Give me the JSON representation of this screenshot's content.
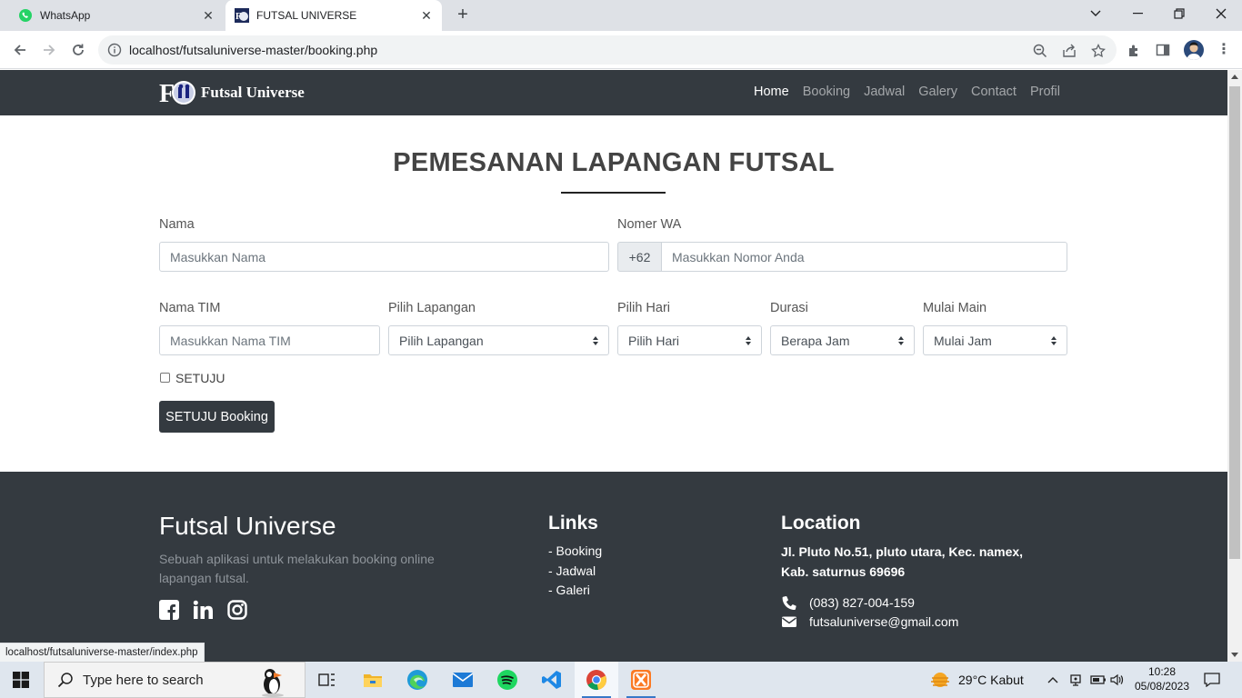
{
  "browser": {
    "tabs": [
      {
        "title": "WhatsApp",
        "icon": "whatsapp-icon"
      },
      {
        "title": "FUTSAL UNIVERSE",
        "icon": "futsal-logo-icon"
      }
    ],
    "url": "localhost/futsaluniverse-master/booking.php",
    "status_url": "localhost/futsaluniverse-master/index.php"
  },
  "site": {
    "brand": "Futsal Universe",
    "nav": [
      "Home",
      "Booking",
      "Jadwal",
      "Galery",
      "Contact",
      "Profil"
    ],
    "active_nav": "Home"
  },
  "form": {
    "title": "PEMESANAN LAPANGAN FUTSAL",
    "nama_label": "Nama",
    "nama_placeholder": "Masukkan Nama",
    "wa_label": "Nomer WA",
    "wa_prefix": "+62",
    "wa_placeholder": "Masukkan Nomor Anda",
    "tim_label": "Nama TIM",
    "tim_placeholder": "Masukkan Nama TIM",
    "lapangan_label": "Pilih Lapangan",
    "lapangan_value": "Pilih Lapangan",
    "hari_label": "Pilih Hari",
    "hari_value": "Pilih Hari",
    "durasi_label": "Durasi",
    "durasi_value": "Berapa Jam",
    "mulai_label": "Mulai Main",
    "mulai_value": "Mulai Jam",
    "agree_label": "SETUJU",
    "submit_label": "SETUJU Booking"
  },
  "footer": {
    "title": "Futsal Universe",
    "description": "Sebuah aplikasi untuk melakukan booking online lapangan futsal.",
    "links_heading": "Links",
    "links": [
      "- Booking",
      "- Jadwal",
      "- Galeri"
    ],
    "location_heading": "Location",
    "address": "Jl. Pluto No.51, pluto utara, Kec. namex, Kab. saturnus 69696",
    "phone": "(083) 827-004-159",
    "email": "futsaluniverse@gmail.com",
    "social": [
      "facebook-icon",
      "linkedin-icon",
      "instagram-icon"
    ]
  },
  "taskbar": {
    "search_placeholder": "Type here to search",
    "weather": "29°C  Kabut",
    "time": "10:28",
    "date": "05/08/2023"
  },
  "colors": {
    "navbar": "#343a40",
    "footer": "#343a40",
    "button": "#343a40"
  }
}
